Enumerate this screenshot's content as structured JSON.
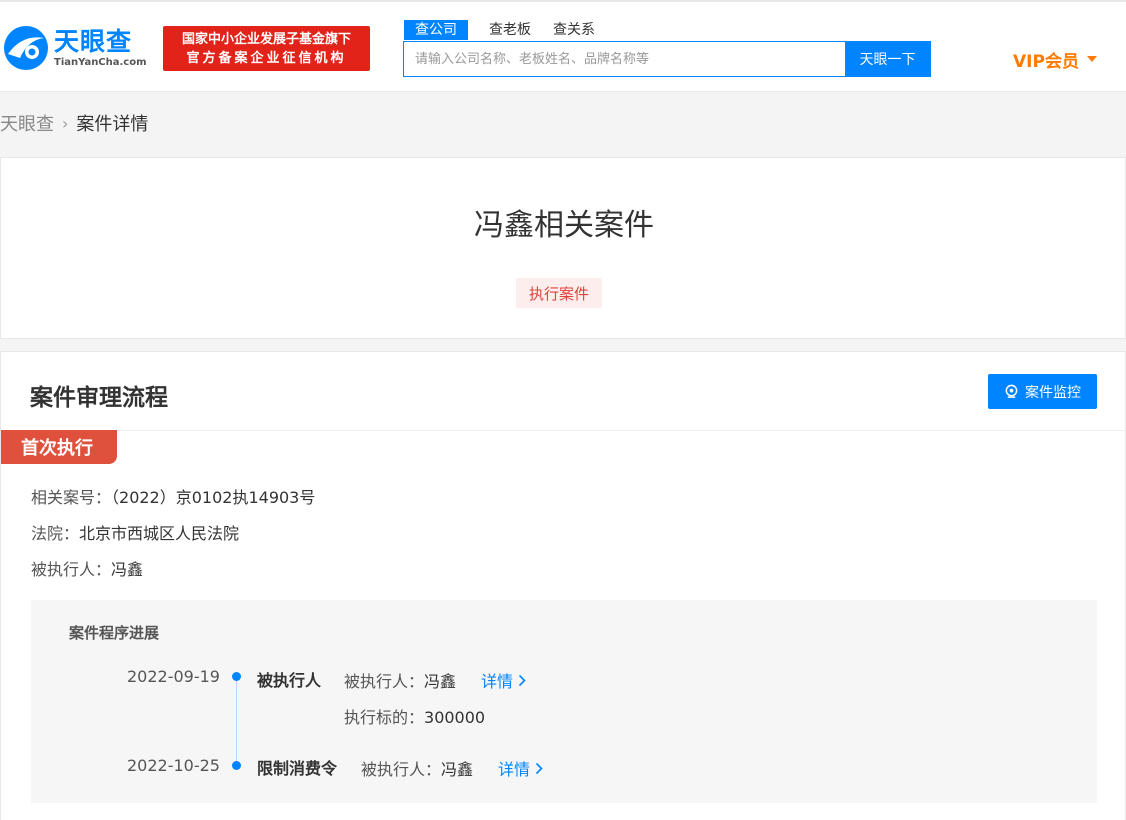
{
  "header": {
    "logo_cn": "天眼查",
    "logo_en": "TianYanCha.com",
    "badge_line1": "国家中小企业发展子基金旗下",
    "badge_line2": "官方备案企业征信机构",
    "search_tabs": [
      "查公司",
      "查老板",
      "查关系"
    ],
    "search_placeholder": "请输入公司名称、老板姓名、品牌名称等",
    "search_button": "天眼一下",
    "vip_label": "VIP会员"
  },
  "breadcrumb": {
    "home": "天眼查",
    "current": "案件详情"
  },
  "case": {
    "title": "冯鑫相关案件",
    "tag": "执行案件"
  },
  "process": {
    "section_title": "案件审理流程",
    "monitor_button": "案件监控",
    "stage": "首次执行",
    "case_no_label": "相关案号：",
    "case_no": "（2022）京0102执14903号",
    "court_label": "法院：",
    "court": "北京市西城区人民法院",
    "executee_label": "被执行人：",
    "executee": "冯鑫",
    "progress_title": "案件程序进展",
    "events": [
      {
        "date": "2022-09-19",
        "type": "被执行人",
        "party_label": "被执行人：",
        "party": "冯鑫",
        "link": "详情",
        "amount_label": "执行标的：",
        "amount": "300000"
      },
      {
        "date": "2022-10-25",
        "type": "限制消费令",
        "party_label": "被执行人：",
        "party": "冯鑫",
        "link": "详情"
      }
    ]
  },
  "colors": {
    "brand_blue": "#0084ff",
    "badge_red": "#e2231a",
    "vip_orange": "#ff7a00",
    "stage_red": "#e0513d"
  }
}
